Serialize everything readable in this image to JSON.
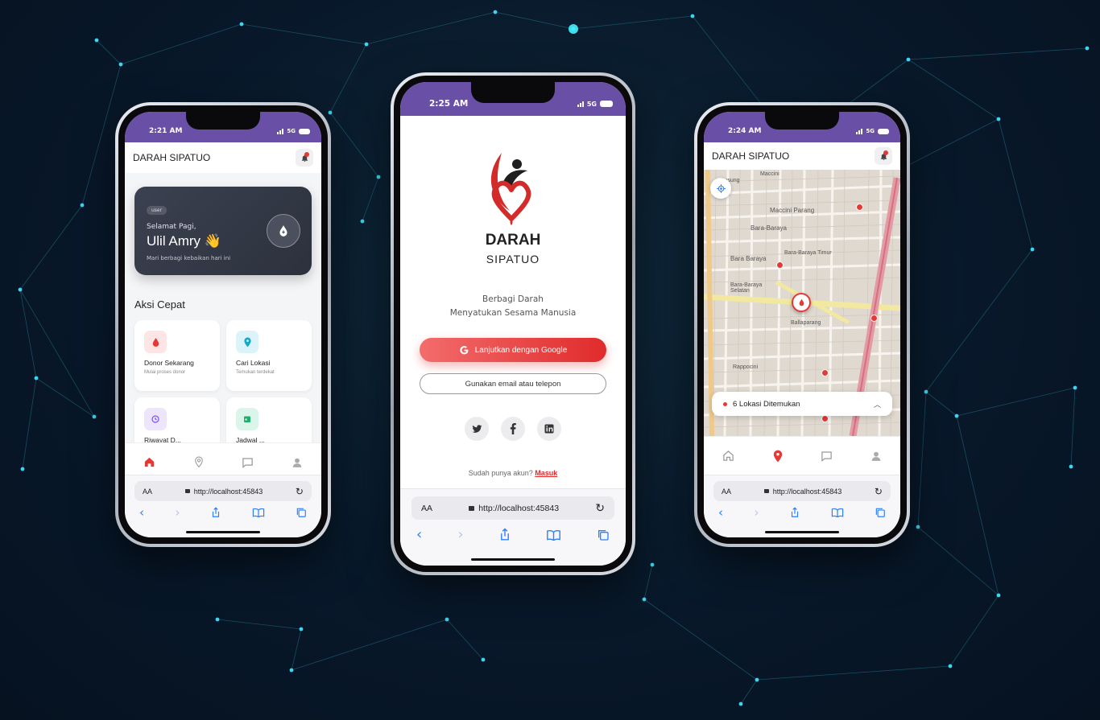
{
  "colors": {
    "background": "#08182a",
    "statusbar": "#6a4fa6",
    "accent_red": "#e02b2b",
    "browser_blue": "#2d7ff9",
    "card_dark": "#343946"
  },
  "phone_left": {
    "status": {
      "time": "2:21 AM",
      "network": "5G"
    },
    "appbar": {
      "title": "DARAH SIPATUO",
      "bell_icon": "bell-icon"
    },
    "greeting_card": {
      "chip": "user",
      "greeting": "Selamat Pagi,",
      "name": "Ulil Amry 👋",
      "tagline": "Mari berbagi kebaikan hari ini",
      "icon": "blood-drop-icon"
    },
    "section_title": "Aksi Cepat",
    "tiles": [
      {
        "title": "Donor Sekarang",
        "subtitle": "Mulai proses donor",
        "icon": "blood-drop-icon"
      },
      {
        "title": "Cari Lokasi",
        "subtitle": "Temukan terdekat",
        "icon": "location-pin-icon"
      },
      {
        "title": "Riwayat D...",
        "subtitle": "",
        "icon": "history-icon"
      },
      {
        "title": "Jadwal ...",
        "subtitle": "",
        "icon": "calendar-icon"
      }
    ],
    "tabbar": [
      "home-icon",
      "location-pin-icon",
      "chat-icon",
      "user-icon"
    ],
    "browser": {
      "text_size": "AA",
      "url": "http://localhost:45843"
    }
  },
  "phone_center": {
    "status": {
      "time": "2:25 AM",
      "network": "5G"
    },
    "logo": {
      "line1": "DARAH",
      "line2": "SIPATUO"
    },
    "tagline": {
      "line1": "Berbagi Darah",
      "line2": "Menyatukan Sesama Manusia"
    },
    "google_button": "Lanjutkan dengan Google",
    "email_button": "Gunakan email atau telepon",
    "social": [
      "twitter-icon",
      "facebook-icon",
      "linkedin-icon"
    ],
    "login_prompt": "Sudah punya akun?",
    "login_link": "Masuk",
    "browser": {
      "text_size": "AA",
      "url": "http://localhost:45843"
    }
  },
  "phone_right": {
    "status": {
      "time": "2:24 AM",
      "network": "5G"
    },
    "appbar": {
      "title": "DARAH SIPATUO"
    },
    "map_labels": [
      "Gusung",
      "Maccini Parang",
      "Bara-Baraya",
      "Bara-Baraya Timur",
      "Bara Baraya",
      "Bara-Baraya Selatan",
      "Ballaparang",
      "Rappocini",
      "Maccini"
    ],
    "locations_panel": "6 Lokasi Ditemukan",
    "tabbar": [
      "home-icon",
      "location-pin-icon",
      "chat-icon",
      "user-icon"
    ],
    "browser": {
      "text_size": "AA",
      "url": "http://localhost:45843"
    }
  }
}
